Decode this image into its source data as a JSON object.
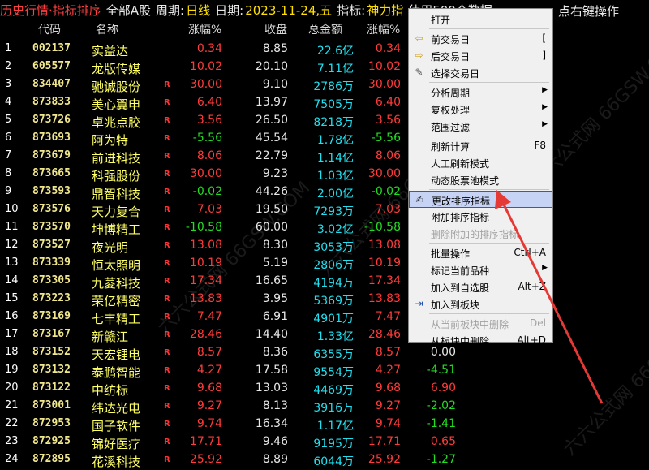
{
  "title_bar": {
    "view": "历史行情·指标排序",
    "scope": "全部A股",
    "period_label": "周期:",
    "period_value": "日线",
    "date_label": "日期:",
    "date_value": "2023-11-24,五",
    "indicator_label": "指标:",
    "indicator_value": "神力指",
    "info_text": "使用500个数据",
    "hint": "点右键操作"
  },
  "columns": {
    "code": "代码",
    "name": "名称",
    "change": "涨幅%",
    "close": "收盘",
    "amount": "总金额",
    "change2": "涨幅%"
  },
  "rows": [
    {
      "idx": "1",
      "code": "002137",
      "name": "实益达",
      "r": "",
      "change": "0.34",
      "close": "8.85",
      "amount": "22.6亿",
      "change2": "0.34"
    },
    {
      "idx": "2",
      "code": "605577",
      "name": "龙版传媒",
      "r": "",
      "change": "10.02",
      "close": "20.10",
      "amount": "7.11亿",
      "change2": "10.02"
    },
    {
      "idx": "3",
      "code": "834407",
      "name": "驰诚股份",
      "r": "R",
      "change": "30.00",
      "close": "9.10",
      "amount": "2786万",
      "change2": "30.00"
    },
    {
      "idx": "4",
      "code": "873833",
      "name": "美心翼申",
      "r": "R",
      "change": "6.40",
      "close": "13.97",
      "amount": "7505万",
      "change2": "6.40"
    },
    {
      "idx": "5",
      "code": "873726",
      "name": "卓兆点胶",
      "r": "R",
      "change": "3.56",
      "close": "26.50",
      "amount": "8218万",
      "change2": "3.56"
    },
    {
      "idx": "6",
      "code": "873693",
      "name": "阿为特",
      "r": "R",
      "change": "-5.56",
      "close": "45.54",
      "amount": "1.78亿",
      "change2": "-5.56"
    },
    {
      "idx": "7",
      "code": "873679",
      "name": "前进科技",
      "r": "R",
      "change": "8.06",
      "close": "22.79",
      "amount": "1.14亿",
      "change2": "8.06"
    },
    {
      "idx": "8",
      "code": "873665",
      "name": "科强股份",
      "r": "R",
      "change": "30.00",
      "close": "9.23",
      "amount": "1.03亿",
      "change2": "30.00"
    },
    {
      "idx": "9",
      "code": "873593",
      "name": "鼎智科技",
      "r": "R",
      "change": "-0.02",
      "close": "44.26",
      "amount": "2.00亿",
      "change2": "-0.02"
    },
    {
      "idx": "10",
      "code": "873576",
      "name": "天力复合",
      "r": "R",
      "change": "7.03",
      "close": "19.50",
      "amount": "7293万",
      "change2": "7.03"
    },
    {
      "idx": "11",
      "code": "873570",
      "name": "坤博精工",
      "r": "R",
      "change": "-10.58",
      "close": "60.00",
      "amount": "3.02亿",
      "change2": "-10.58"
    },
    {
      "idx": "12",
      "code": "873527",
      "name": "夜光明",
      "r": "R",
      "change": "13.08",
      "close": "8.30",
      "amount": "3053万",
      "change2": "13.08"
    },
    {
      "idx": "13",
      "code": "873339",
      "name": "恒太照明",
      "r": "R",
      "change": "10.19",
      "close": "5.19",
      "amount": "2806万",
      "change2": "10.19"
    },
    {
      "idx": "14",
      "code": "873305",
      "name": "九菱科技",
      "r": "R",
      "change": "17.34",
      "close": "16.65",
      "amount": "4194万",
      "change2": "17.34"
    },
    {
      "idx": "15",
      "code": "873223",
      "name": "荣亿精密",
      "r": "R",
      "change": "13.83",
      "close": "3.95",
      "amount": "5369万",
      "change2": "13.83"
    },
    {
      "idx": "16",
      "code": "873169",
      "name": "七丰精工",
      "r": "R",
      "change": "7.47",
      "close": "6.91",
      "amount": "4901万",
      "change2": "7.47"
    },
    {
      "idx": "17",
      "code": "873167",
      "name": "新赣江",
      "r": "R",
      "change": "28.46",
      "close": "14.40",
      "amount": "1.33亿",
      "change2": "28.46"
    },
    {
      "idx": "18",
      "code": "873152",
      "name": "天宏锂电",
      "r": "R",
      "change": "8.57",
      "close": "8.36",
      "amount": "6355万",
      "change2": "8.57"
    },
    {
      "idx": "19",
      "code": "873132",
      "name": "泰鹏智能",
      "r": "R",
      "change": "4.27",
      "close": "17.58",
      "amount": "9554万",
      "change2": "4.27"
    },
    {
      "idx": "20",
      "code": "873122",
      "name": "中纺标",
      "r": "R",
      "change": "9.68",
      "close": "13.03",
      "amount": "4469万",
      "change2": "9.68"
    },
    {
      "idx": "21",
      "code": "873001",
      "name": "纬达光电",
      "r": "R",
      "change": "9.27",
      "close": "8.13",
      "amount": "3916万",
      "change2": "9.27"
    },
    {
      "idx": "22",
      "code": "872953",
      "name": "国子软件",
      "r": "R",
      "change": "9.74",
      "close": "16.34",
      "amount": "1.17亿",
      "change2": "9.74"
    },
    {
      "idx": "23",
      "code": "872925",
      "name": "锦好医疗",
      "r": "R",
      "change": "17.71",
      "close": "9.46",
      "amount": "9195万",
      "change2": "17.71"
    },
    {
      "idx": "24",
      "code": "872895",
      "name": "花溪科技",
      "r": "R",
      "change": "25.92",
      "close": "8.89",
      "amount": "6044万",
      "change2": "25.92"
    }
  ],
  "extra_column_values": [
    {
      "row": 18,
      "value": "0.00"
    },
    {
      "row": 19,
      "value": "-4.51"
    },
    {
      "row": 20,
      "value": "6.90"
    },
    {
      "row": 21,
      "value": "-2.02"
    },
    {
      "row": 22,
      "value": "-1.41"
    },
    {
      "row": 23,
      "value": "0.65"
    },
    {
      "row": 24,
      "value": "-1.27"
    }
  ],
  "context_menu": {
    "items": [
      {
        "label": "打开",
        "shortcut": "",
        "icon": "",
        "submenu": false,
        "disabled": false,
        "highlighted": false
      },
      {
        "label": "前交易日",
        "shortcut": "[",
        "icon": "arrow-left-icon",
        "submenu": false,
        "disabled": false,
        "highlighted": false
      },
      {
        "label": "后交易日",
        "shortcut": "]",
        "icon": "arrow-right-icon",
        "submenu": false,
        "disabled": false,
        "highlighted": false
      },
      {
        "label": "选择交易日",
        "shortcut": "",
        "icon": "calendar-pick-icon",
        "submenu": false,
        "disabled": false,
        "highlighted": false
      },
      {
        "label": "分析周期",
        "shortcut": "",
        "icon": "",
        "submenu": true,
        "disabled": false,
        "highlighted": false
      },
      {
        "label": "复权处理",
        "shortcut": "",
        "icon": "",
        "submenu": true,
        "disabled": false,
        "highlighted": false
      },
      {
        "label": "范围过滤",
        "shortcut": "",
        "icon": "",
        "submenu": true,
        "disabled": false,
        "highlighted": false
      },
      {
        "label": "刷新计算",
        "shortcut": "F8",
        "icon": "",
        "submenu": false,
        "disabled": false,
        "highlighted": false
      },
      {
        "label": "人工刷新模式",
        "shortcut": "",
        "icon": "",
        "submenu": false,
        "disabled": false,
        "highlighted": false
      },
      {
        "label": "动态股票池模式",
        "shortcut": "",
        "icon": "",
        "submenu": false,
        "disabled": false,
        "highlighted": false
      },
      {
        "label": "更改排序指标",
        "shortcut": "",
        "icon": "edit-indicator-icon",
        "submenu": false,
        "disabled": false,
        "highlighted": true
      },
      {
        "label": "附加排序指标",
        "shortcut": "",
        "icon": "",
        "submenu": false,
        "disabled": false,
        "highlighted": false
      },
      {
        "label": "删除附加的排序指标",
        "shortcut": "",
        "icon": "",
        "submenu": false,
        "disabled": true,
        "highlighted": false
      },
      {
        "label": "批量操作",
        "shortcut": "Ctrl+A",
        "icon": "",
        "submenu": false,
        "disabled": false,
        "highlighted": false
      },
      {
        "label": "标记当前品种",
        "shortcut": "",
        "icon": "",
        "submenu": true,
        "disabled": false,
        "highlighted": false
      },
      {
        "label": "加入到自选股",
        "shortcut": "Alt+Z",
        "icon": "",
        "submenu": false,
        "disabled": false,
        "highlighted": false
      },
      {
        "label": "加入到板块",
        "shortcut": "",
        "icon": "add-to-block-icon",
        "submenu": false,
        "disabled": false,
        "highlighted": false
      },
      {
        "label": "从当前板块中删除",
        "shortcut": "Del",
        "icon": "",
        "submenu": false,
        "disabled": true,
        "highlighted": false
      },
      {
        "label": "从板块中删除",
        "shortcut": "Alt+D",
        "icon": "",
        "submenu": false,
        "disabled": false,
        "highlighted": false
      }
    ]
  },
  "watermark_text": "六六公式网 66GSW.COM",
  "colors": {
    "background": "#000000",
    "up": "#ff3b3b",
    "down": "#22dd22",
    "flat": "#e8e8e8",
    "code": "#f0e68c",
    "name": "#ffff66",
    "amount": "#20e0f0",
    "menu_bg": "#f0f0f0",
    "menu_highlight": "#c6d3f4",
    "annotation_arrow": "#e53935"
  }
}
